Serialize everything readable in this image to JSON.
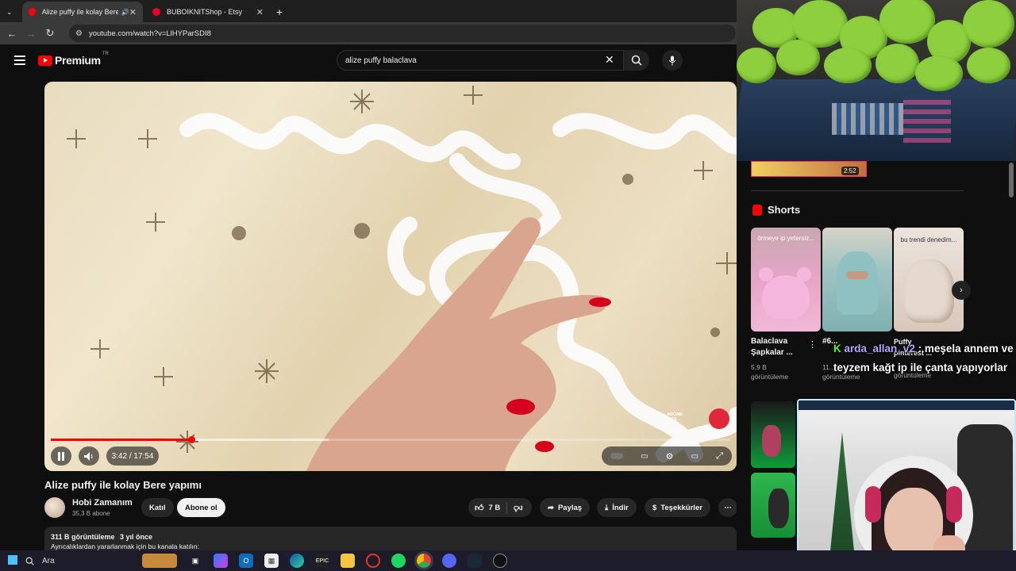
{
  "tabs": [
    {
      "label": "Alize puffy ile kolay Bere ya",
      "active": true
    },
    {
      "label": "BUBOIKNITShop - Etsy",
      "active": false
    }
  ],
  "browser": {
    "url": "youtube.com/watch?v=LlHYParSDI8"
  },
  "youtube": {
    "logo_text": "Premium",
    "logo_region": "TR",
    "search_value": "alize puffy balaclava"
  },
  "player": {
    "time": "3:42 / 17:54",
    "progress": 0.207,
    "abone_badge": "ABONE OL"
  },
  "video": {
    "title": "Alize puffy ile kolay Bere yapımı",
    "channel": "Hobi Zamanım",
    "subscribers": "35,3 B abone",
    "join_label": "Katıl",
    "subscribe_label": "Abone ol",
    "likes": "7 B",
    "share_label": "Paylaş",
    "download_label": "İndir",
    "thanks_label": "Teşekkürler",
    "views": "311 B görüntüleme",
    "ago": "3 yıl önce",
    "desc_line": "Ayrıcalıklardan yararlanmak için bu kanala katılın:"
  },
  "sidebar": {
    "prev_duration": "2:52",
    "shorts_heading": "Shorts",
    "shorts": [
      {
        "title": "Balaclava Şapkalar ...",
        "views": "5,9 B",
        "views_label": "görüntüleme",
        "caption": "örmeye ip yetersiz..."
      },
      {
        "title": "#6...",
        "views": "11...",
        "views_label": "görüntüleme",
        "caption": ""
      },
      {
        "title": "Puffy pinterest ...",
        "views": "",
        "views_label": "görüntüleme",
        "caption": "bu trendi denedim..."
      }
    ]
  },
  "chat": {
    "user": "arda_allan_v2",
    "message": "meşela annem ve teyzem kağt ip ile çanta yapıyorlar"
  },
  "taskbar": {
    "search_label": "Ara"
  },
  "colors": {
    "accent": "#ff0000",
    "background": "#0f0f0f",
    "chip": "#272727"
  }
}
